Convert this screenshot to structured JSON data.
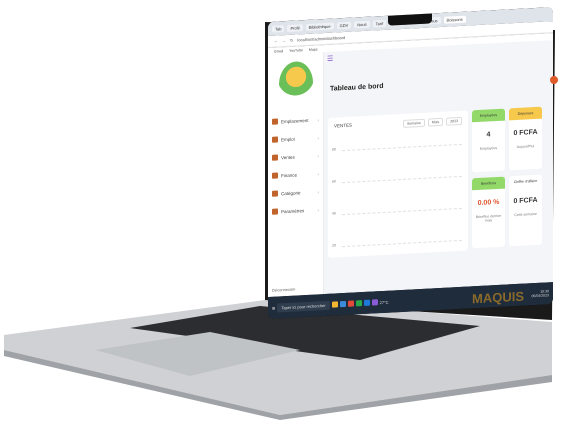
{
  "browser": {
    "tabs": [
      "Tab",
      "Profil",
      "Bibliothèque",
      "GDV",
      "Nous",
      "Tarif",
      "Crée",
      "Nous",
      "Nous",
      "Boissons"
    ],
    "url": "localhost/admin/dashboard",
    "bookmarks": [
      "Gmail",
      "YouTube",
      "Maps"
    ]
  },
  "sidebar": {
    "items": [
      {
        "label": "Emplacement"
      },
      {
        "label": "Emploi"
      },
      {
        "label": "Ventes"
      },
      {
        "label": "Finance"
      },
      {
        "label": "Catégorie"
      },
      {
        "label": "Paramètres"
      }
    ],
    "footer": "Déconnexion"
  },
  "main": {
    "title": "Tableau de bord",
    "chart_label": "VENTES",
    "selects": [
      "Semaine",
      "Mois",
      "2023"
    ],
    "ticks": [
      "80",
      "60",
      "40",
      "20"
    ]
  },
  "kpis": [
    {
      "head": "Employées",
      "value": "4",
      "sub": "Employées",
      "color": "#93d96a"
    },
    {
      "head": "Dépenses",
      "value": "0 FCFA",
      "sub": "Aujourd'hui",
      "color": "#f6c84c"
    },
    {
      "head": "Bénéfices",
      "value": "0.00 %",
      "sub": "Bénéfice dernier mois",
      "color": "#93d96a"
    },
    {
      "head": "Chiffre d'affaire",
      "value": "0 FCFA",
      "sub": "Cette semaine",
      "color": "#ffffff"
    }
  ],
  "taskbar": {
    "search": "Taper ici pour rechercher",
    "weather": "27°C",
    "time": "10:30",
    "date": "05/04/2023"
  },
  "watermark": "MAQUIS"
}
